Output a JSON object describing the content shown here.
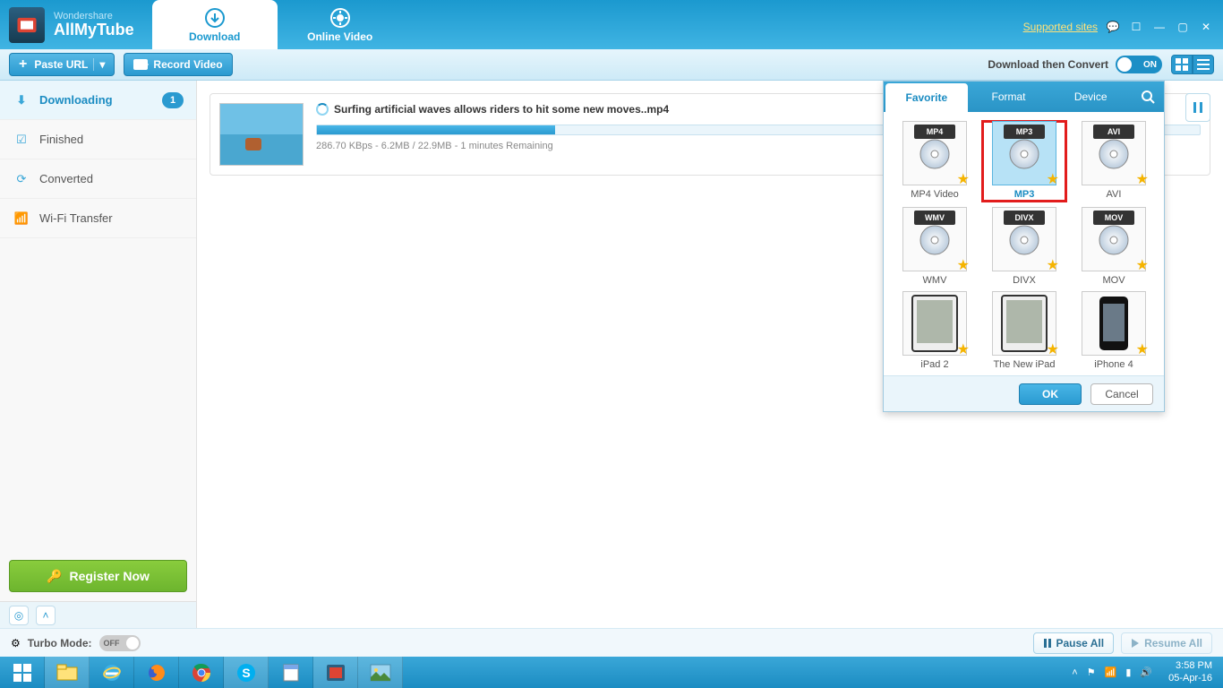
{
  "header": {
    "brand": "Wondershare",
    "app_name": "AllMyTube",
    "tabs": {
      "download": "Download",
      "online": "Online Video"
    },
    "supported_sites": "Supported sites"
  },
  "toolbar": {
    "paste_url": "Paste URL",
    "record_video": "Record Video",
    "dtc_label": "Download then Convert",
    "dtc_toggle": "ON"
  },
  "sidebar": {
    "items": [
      {
        "label": "Downloading",
        "badge": "1"
      },
      {
        "label": "Finished"
      },
      {
        "label": "Converted"
      },
      {
        "label": "Wi-Fi Transfer"
      }
    ],
    "register": "Register Now"
  },
  "download": {
    "title": "Surfing artificial waves allows riders to hit some new moves..mp4",
    "percent_text": "27%",
    "percent": 27,
    "meta": "286.70 KBps - 6.2MB / 22.9MB - 1 minutes Remaining"
  },
  "format_popup": {
    "tabs": {
      "favorite": "Favorite",
      "format": "Format",
      "device": "Device"
    },
    "items": [
      {
        "label": "MP4 Video",
        "badge": "MP4"
      },
      {
        "label": "MP3",
        "badge": "MP3",
        "selected": true,
        "highlight": true
      },
      {
        "label": "AVI",
        "badge": "AVI"
      },
      {
        "label": "WMV",
        "badge": "WMV"
      },
      {
        "label": "DIVX",
        "badge": "DIVX"
      },
      {
        "label": "MOV",
        "badge": "MOV"
      },
      {
        "label": "iPad 2",
        "device": "ipad"
      },
      {
        "label": "The New iPad",
        "device": "ipad"
      },
      {
        "label": "iPhone 4",
        "device": "iphone"
      }
    ],
    "ok": "OK",
    "cancel": "Cancel"
  },
  "bottom": {
    "turbo_label": "Turbo Mode:",
    "turbo_toggle": "OFF",
    "pause_all": "Pause All",
    "resume_all": "Resume All"
  },
  "tray": {
    "time": "3:58 PM",
    "date": "05-Apr-16"
  }
}
